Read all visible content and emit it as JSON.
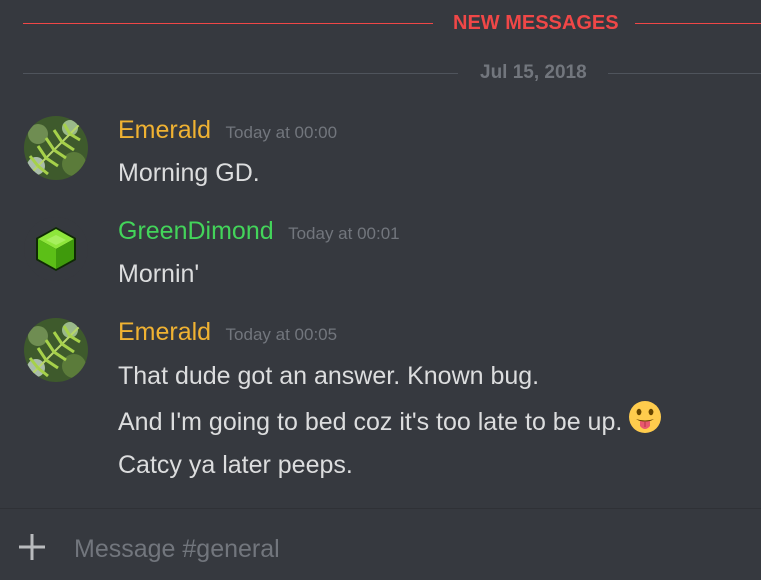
{
  "dividers": {
    "new_messages": "NEW MESSAGES",
    "date": "Jul 15, 2018"
  },
  "colors": {
    "emerald": "#f0b232",
    "greendimond": "#43d45a",
    "new_messages": "#f04747",
    "background": "#36393f"
  },
  "messages": [
    {
      "username": "Emerald",
      "timestamp": "Today at 00:00",
      "avatar_icon": "fern-avatar-icon",
      "lines": [
        "Morning GD."
      ]
    },
    {
      "username": "GreenDimond",
      "timestamp": "Today at 00:01",
      "avatar_icon": "green-cube-avatar-icon",
      "lines": [
        "Mornin'"
      ]
    },
    {
      "username": "Emerald",
      "timestamp": "Today at 00:05",
      "avatar_icon": "fern-avatar-icon",
      "lines": [
        "That dude got an answer. Known bug.",
        "And I'm going to bed coz it's too late to be up.",
        "Catcy ya later peeps."
      ],
      "emoji": "tongue-out-emoji-icon"
    }
  ],
  "input": {
    "placeholder": "Message #general",
    "value": "",
    "add_icon": "plus-icon"
  }
}
